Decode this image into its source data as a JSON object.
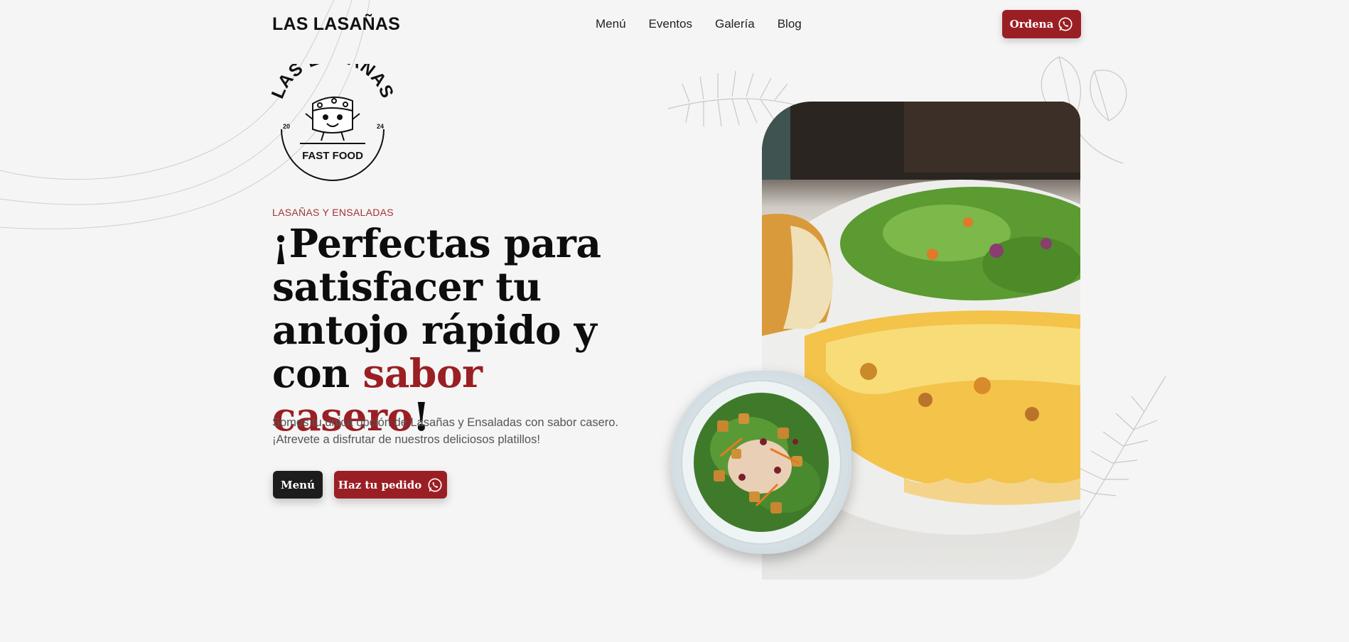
{
  "header": {
    "brand": "LAS LASAÑAS",
    "nav": [
      "Menú",
      "Eventos",
      "Galería",
      "Blog"
    ],
    "order_label": "Ordena"
  },
  "logo": {
    "arc_text": "LAS LASAÑAS",
    "year_left": "20",
    "year_right": "24",
    "bottom_text": "FAST FOOD"
  },
  "hero": {
    "eyebrow": "LASAÑAS Y ENSALADAS",
    "headline_pre": "¡Perfectas para satisfacer tu antojo rápido y con ",
    "headline_accent": "sabor casero",
    "headline_post": "!",
    "description_line1": "Somos tu única opción de Lasañas y Ensaladas con sabor casero.",
    "description_line2": "¡Atrevete a disfrutar de nuestros deliciosos platillos!",
    "menu_button": "Menú",
    "order_button": "Haz tu pedido"
  },
  "colors": {
    "accent": "#9a1f24",
    "dark": "#1c1c1c",
    "background": "#f5f5f5"
  },
  "icons": {
    "order": "whatsapp-icon",
    "cta": "whatsapp-icon"
  }
}
